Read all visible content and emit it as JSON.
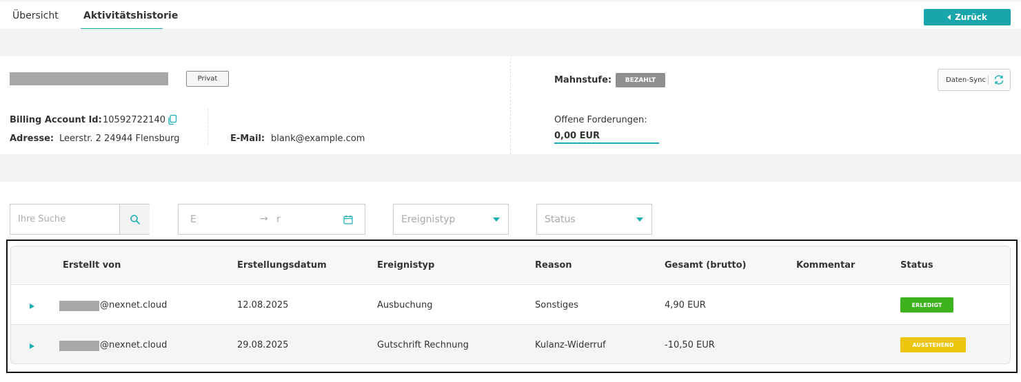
{
  "tabs": [
    {
      "label": "Übersicht",
      "active": false
    },
    {
      "label": "Aktivitätshistorie",
      "active": true
    }
  ],
  "back_button": {
    "label": "Zurück",
    "icon": "caret-left-icon"
  },
  "account": {
    "type_badge": "Privat",
    "billing_id_label": "Billing Account Id:",
    "billing_id_value": "10592722140",
    "address_label": "Adresse:",
    "address_value": "Leerstr. 2 24944 Flensburg",
    "email_label": "E-Mail:",
    "email_value": "blank@example.com",
    "mahnstufe_label": "Mahnstufe:",
    "mahnstufe_value": "BEZAHLT",
    "sync_label": "Daten-Sync",
    "open_claims_label": "Offene Forderungen:",
    "open_claims_value": "0,00 EUR"
  },
  "filters": {
    "search_placeholder": "Ihre Suche",
    "date_start_placeholder": "E",
    "date_arrow": "→",
    "date_end_placeholder": "r",
    "event_type_placeholder": "Ereignistyp",
    "status_placeholder": "Status"
  },
  "table": {
    "columns": [
      "Erstellt von",
      "Erstellungsdatum",
      "Ereignistyp",
      "Reason",
      "Gesamt (brutto)",
      "Kommentar",
      "Status"
    ],
    "rows": [
      {
        "created_by": "@nexnet.cloud",
        "date": "12.08.2025",
        "event_type": "Ausbuchung",
        "reason": "Sonstiges",
        "total": "4,90 EUR",
        "comment": "",
        "status": "ERLEDIGT"
      },
      {
        "created_by": "@nexnet.cloud",
        "date": "29.08.2025",
        "event_type": "Gutschrift Rechnung",
        "reason": "Kulanz-Widerruf",
        "total": "-10,50 EUR",
        "comment": "",
        "status": "AUSSTEHEND"
      }
    ]
  },
  "colors": {
    "accent": "#18aeb3",
    "status_done": "#3cb21c",
    "status_pending": "#ecc50d",
    "badge_gray": "#8f8f8f"
  }
}
